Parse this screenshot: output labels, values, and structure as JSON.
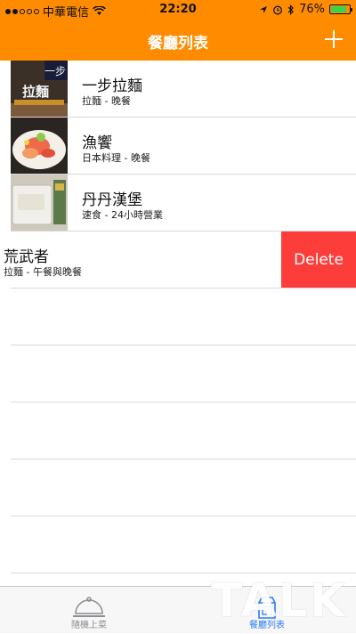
{
  "status_bar": {
    "carrier": "中華電信",
    "time": "22:20",
    "battery": "76%"
  },
  "nav": {
    "title": "餐廳列表"
  },
  "restaurants": [
    {
      "name": "一步拉麵",
      "detail": "拉麵 - 晚餐",
      "thumb_text": "拉麵"
    },
    {
      "name": "漁饗",
      "detail": "日本料理 - 晚餐"
    },
    {
      "name": "丹丹漢堡",
      "detail": "速食 - 24小時營業"
    },
    {
      "name": "荒武者",
      "detail": "拉麵 - 午餐與晚餐"
    }
  ],
  "delete_label": "Delete",
  "tabs": [
    {
      "label": "隨機上菜",
      "icon": "service-bell-icon"
    },
    {
      "label": "餐廳列表",
      "icon": "milk-carton-icon"
    }
  ],
  "colors": {
    "brand": "#ff8c00",
    "delete": "#fc3d39",
    "tab_active": "#2f7cf6",
    "tab_inactive": "#8e8e93"
  },
  "watermark": "TALK"
}
